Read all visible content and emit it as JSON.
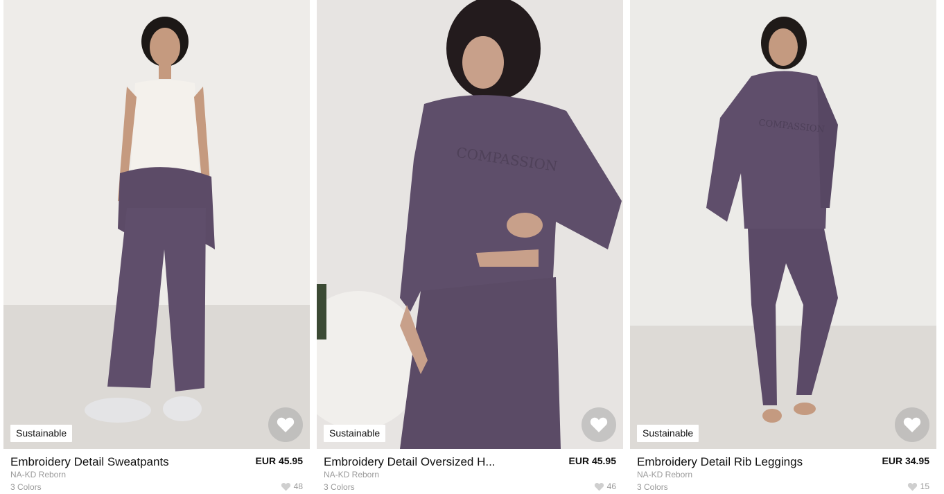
{
  "products": [
    {
      "badge": "Sustainable",
      "title": "Embroidery Detail Sweatpants",
      "price": "EUR 45.95",
      "brand": "NA-KD Reborn",
      "colors": "3 Colors",
      "likes": "48",
      "image": "model wearing purple sweatpants with white tank top and sweatshirt tied around waist"
    },
    {
      "badge": "Sustainable",
      "title": "Embroidery Detail Oversized H...",
      "price": "EUR 45.95",
      "brand": "NA-KD Reborn",
      "colors": "3 Colors",
      "likes": "46",
      "image": "model wearing purple oversized hoodie with COMPASSION embroidery and matching sweatpants"
    },
    {
      "badge": "Sustainable",
      "title": "Embroidery Detail Rib Leggings",
      "price": "EUR 34.95",
      "brand": "NA-KD Reborn",
      "colors": "3 Colors",
      "likes": "15",
      "image": "model wearing purple oversized hoodie and purple rib leggings, barefoot"
    }
  ],
  "embroidery_text": "COMPASSION",
  "icons": {
    "favorite": "heart-icon",
    "likes": "heart-small-icon"
  },
  "colors": {
    "garment_purple": "#5f4e6b",
    "background": "#ffffff",
    "muted_text": "#9a9a9a"
  }
}
